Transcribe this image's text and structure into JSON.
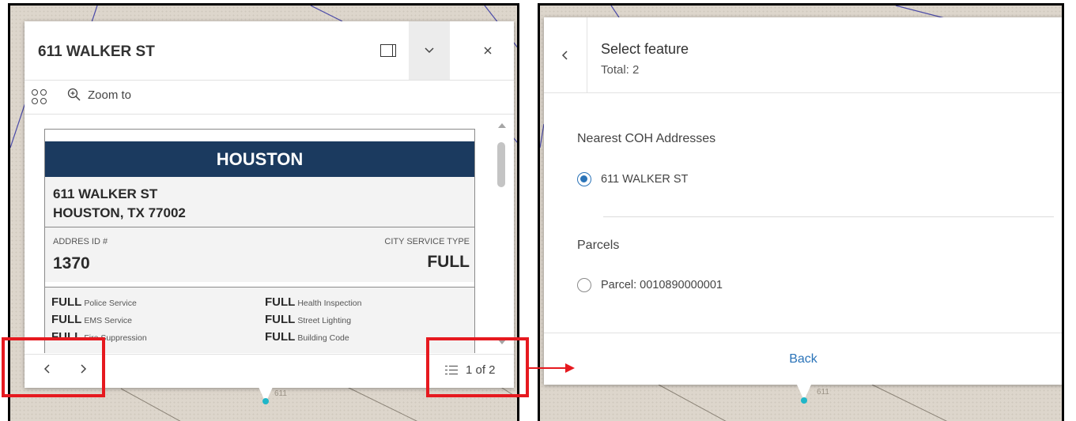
{
  "left_popup": {
    "title": "611 WALKER ST",
    "toolbar": {
      "zoom_label": "Zoom to"
    },
    "feature": {
      "city": "HOUSTON",
      "address_line1": "611 WALKER ST",
      "address_line2": "HOUSTON, TX 77002",
      "id_label": "ADDRES ID #",
      "id_value": "1370",
      "service_type_label": "CITY SERVICE TYPE",
      "service_type_value": "FULL",
      "services": [
        {
          "level": "FULL",
          "name": "Police Service"
        },
        {
          "level": "FULL",
          "name": "Health Inspection"
        },
        {
          "level": "FULL",
          "name": "EMS Service"
        },
        {
          "level": "FULL",
          "name": "Street Lighting"
        },
        {
          "level": "FULL",
          "name": "Fire Suppression"
        },
        {
          "level": "FULL",
          "name": "Building Code"
        }
      ]
    },
    "pager": {
      "label": "1 of 2"
    }
  },
  "right_popup": {
    "title": "Select feature",
    "total": "Total: 2",
    "groups": [
      {
        "name": "Nearest COH Addresses",
        "option": "611 WALKER ST",
        "selected": true
      },
      {
        "name": "Parcels",
        "option": "Parcel: 0010890000001",
        "selected": false
      }
    ],
    "back_label": "Back"
  },
  "map_labels": {
    "left": "611",
    "right": "611"
  },
  "colors": {
    "banner": "#1b3a5f",
    "highlight": "#e6191f",
    "accent": "#2a73b8"
  },
  "icons": {
    "dock": "dock-icon",
    "collapse": "chevron-down-icon",
    "close": "close-icon",
    "actions": "actions-grid-icon",
    "zoom": "zoom-in-icon",
    "prev": "chevron-left-icon",
    "next": "chevron-right-icon",
    "list": "list-icon"
  }
}
